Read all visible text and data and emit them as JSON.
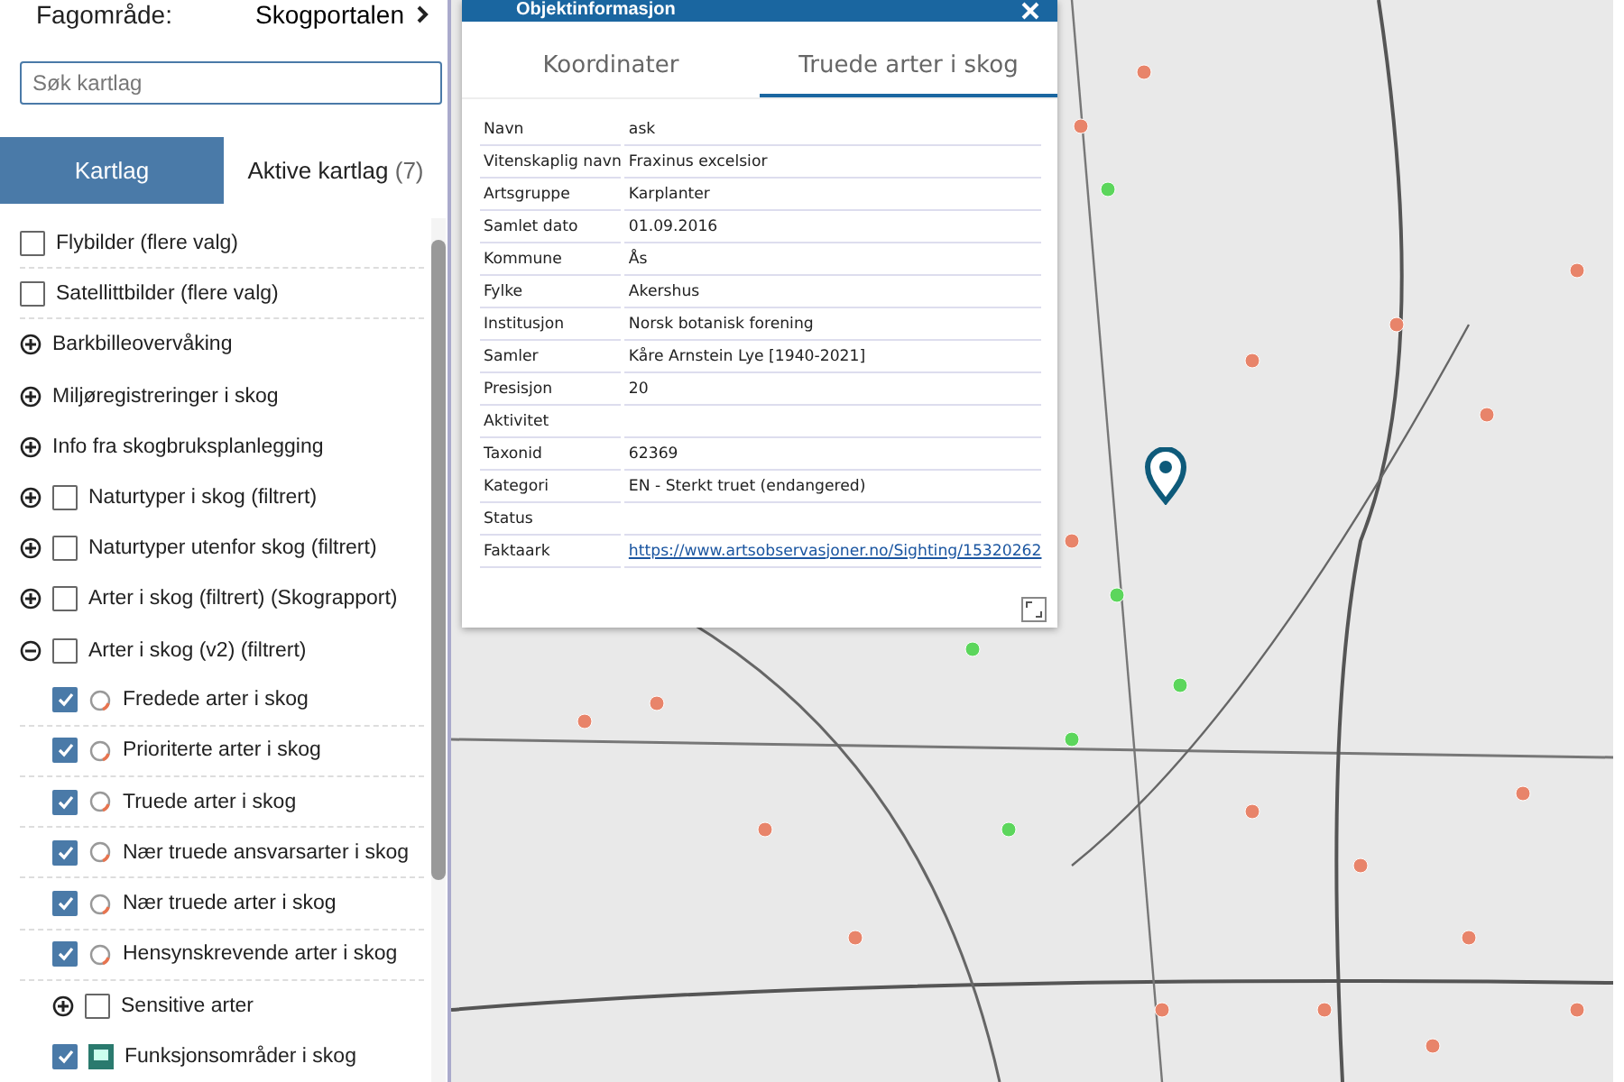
{
  "sidebar": {
    "subject_label": "Fagområde:",
    "subject_value": "Skogportalen",
    "search": {
      "placeholder": "Søk kartlag"
    },
    "tabs": [
      {
        "label": "Kartlag",
        "selected": true
      },
      {
        "label": "Aktive kartlag",
        "count": "(7)",
        "selected": false
      }
    ],
    "layers": [
      {
        "kind": "layer",
        "label": "Flybilder (flere valg)",
        "checked": false
      },
      {
        "kind": "layer",
        "label": "Satellittbilder (flere valg)",
        "checked": false
      },
      {
        "kind": "folder",
        "label": "Barkbilleovervåking",
        "expanded": false
      },
      {
        "kind": "folder",
        "label": "Miljøregistreringer i skog",
        "expanded": false
      },
      {
        "kind": "folder",
        "label": "Info fra skogbruksplanlegging",
        "expanded": false
      },
      {
        "kind": "folder_layer",
        "label": "Naturtyper i skog (filtrert)",
        "expanded": false,
        "checked": false
      },
      {
        "kind": "folder_layer",
        "label": "Naturtyper utenfor skog (filtrert)",
        "expanded": false,
        "checked": false
      },
      {
        "kind": "folder_layer",
        "label": "Arter i skog (filtrert) (Skograpport)",
        "expanded": false,
        "checked": false
      },
      {
        "kind": "folder_layer",
        "label": "Arter i skog (v2) (filtrert)",
        "expanded": true,
        "checked": false,
        "children": [
          {
            "kind": "species_layer",
            "label": "Fredede arter i skog",
            "checked": true
          },
          {
            "kind": "species_layer",
            "label": "Prioriterte arter i skog",
            "checked": true
          },
          {
            "kind": "species_layer",
            "label": "Truede arter i skog",
            "checked": true
          },
          {
            "kind": "species_layer",
            "label": "Nær truede ansvarsarter i skog",
            "checked": true
          },
          {
            "kind": "species_layer",
            "label": "Nær truede arter i skog",
            "checked": true
          },
          {
            "kind": "species_layer",
            "label": "Hensynskrevende arter i skog",
            "checked": true
          },
          {
            "kind": "folder_layer",
            "label": "Sensitive arter",
            "expanded": false,
            "checked": false
          },
          {
            "kind": "area_layer",
            "label": "Funksjonsområder i skog",
            "checked": true
          }
        ]
      }
    ]
  },
  "popup": {
    "title": "Objektinformasjon",
    "tabs": [
      {
        "label": "Koordinater",
        "selected": false
      },
      {
        "label": "Truede arter i skog",
        "selected": true
      }
    ],
    "rows": [
      {
        "label": "Navn",
        "value": "ask"
      },
      {
        "label": "Vitenskaplig navn",
        "value": "Fraxinus excelsior"
      },
      {
        "label": "Artsgruppe",
        "value": "Karplanter"
      },
      {
        "label": "Samlet dato",
        "value": "01.09.2016"
      },
      {
        "label": "Kommune",
        "value": "Ås"
      },
      {
        "label": "Fylke",
        "value": "Akershus"
      },
      {
        "label": "Institusjon",
        "value": "Norsk botanisk forening"
      },
      {
        "label": "Samler",
        "value": "Kåre Arnstein Lye [1940-2021]"
      },
      {
        "label": "Presisjon",
        "value": "20"
      },
      {
        "label": "Aktivitet"
      },
      {
        "label": "Taxonid",
        "value": "62369"
      },
      {
        "label": "Kategori",
        "value": "EN - Sterkt truet (endangered)"
      },
      {
        "label": "Status"
      },
      {
        "label": "Faktaark",
        "link": "https://www.artsobservasjoner.no/Sighting/15320262"
      }
    ]
  }
}
